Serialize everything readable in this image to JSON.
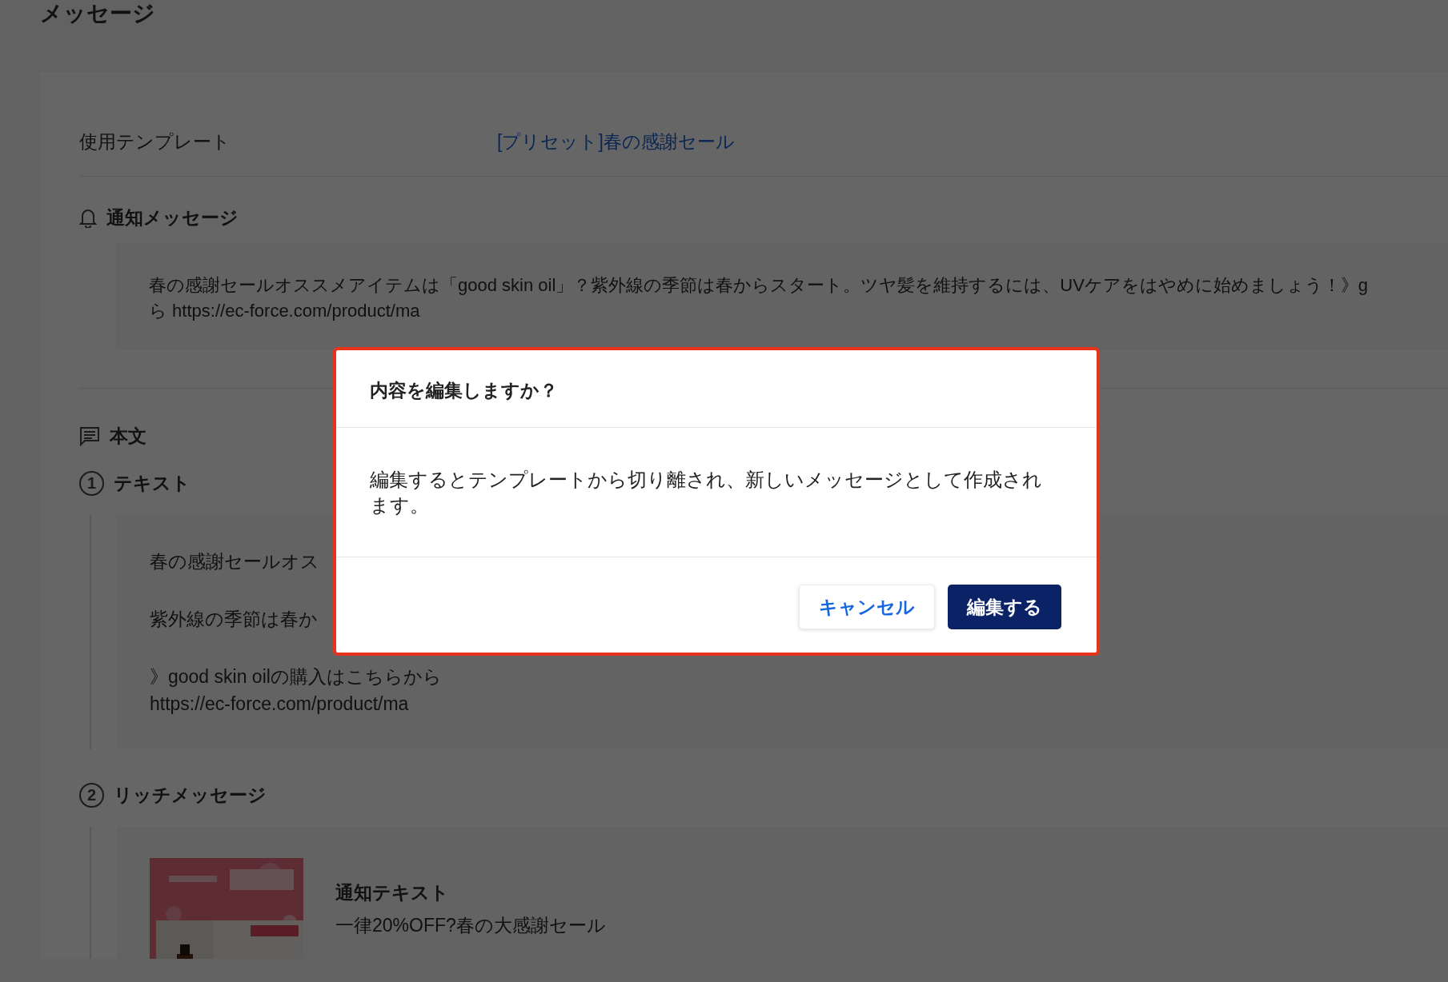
{
  "page": {
    "title": "メッセージ"
  },
  "template": {
    "label": "使用テンプレート",
    "link": "[プリセット]春の感謝セール"
  },
  "notification": {
    "heading": "通知メッセージ",
    "lines": [
      "春の感謝セールオススメアイテムは「good skin oil」？紫外線の季節は春からスタート。ツヤ髪を維持するには、UVケアをはやめに始めましょう！》g",
      "ら https://ec-force.com/product/ma"
    ]
  },
  "body": {
    "heading": "本文",
    "sections": [
      {
        "kind": "text",
        "number": "1",
        "title": "テキスト",
        "paragraphs": [
          [
            "春の感謝セールオス"
          ],
          [
            "紫外線の季節は春か"
          ],
          [
            "》good skin oilの購入はこちらから",
            "https://ec-force.com/product/ma"
          ]
        ]
      },
      {
        "kind": "rich",
        "number": "2",
        "title": "リッチメッセージ",
        "caption_title": "通知テキスト",
        "caption": "一律20%OFF?春の大感謝セール"
      }
    ]
  },
  "dialog": {
    "title": "内容を編集しますか？",
    "message": "編集するとテンプレートから切り離され、新しいメッセージとして作成されます。",
    "buttons": [
      {
        "kind": "secondary",
        "label": "キャンセル"
      },
      {
        "kind": "primary",
        "label": "編集する"
      }
    ]
  }
}
